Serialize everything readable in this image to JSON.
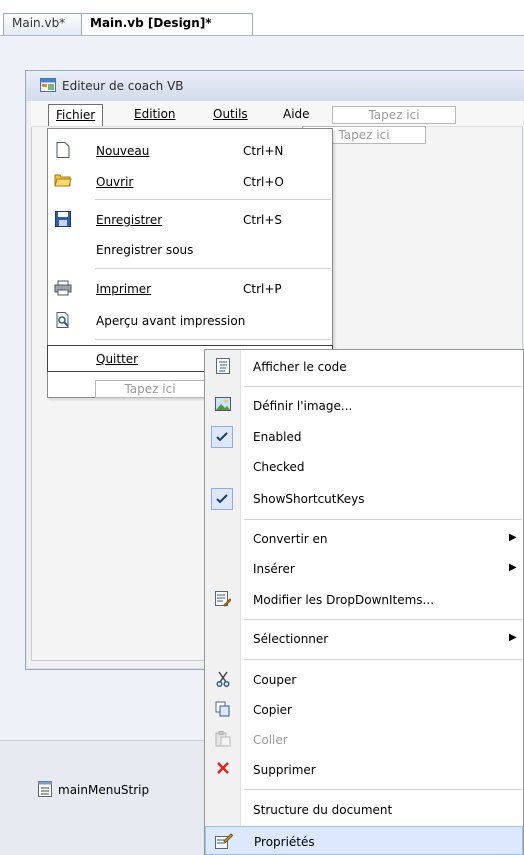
{
  "tabs": [
    {
      "label": "Main.vb*"
    },
    {
      "label": "Main.vb [Design]*"
    }
  ],
  "form": {
    "title": "Editeur de coach VB"
  },
  "menubar": {
    "items": [
      {
        "label": "Fichier"
      },
      {
        "label": "Edition"
      },
      {
        "label": "Outils"
      },
      {
        "label": "Aide"
      }
    ],
    "placeholder_top": "Tapez ici",
    "placeholder_sub": "Tapez ici",
    "placeholder_dropdown": "Tapez ici"
  },
  "fichier_menu": {
    "items": [
      {
        "label": "Nouveau",
        "shortcut": "Ctrl+N",
        "icon": "new-document-icon"
      },
      {
        "label": "Ouvrir",
        "shortcut": "Ctrl+O",
        "icon": "open-folder-icon"
      },
      {
        "label": "Enregistrer",
        "shortcut": "Ctrl+S",
        "icon": "save-icon"
      },
      {
        "label": "Enregistrer sous",
        "shortcut": "",
        "icon": ""
      },
      {
        "label": "Imprimer",
        "shortcut": "Ctrl+P",
        "icon": "print-icon"
      },
      {
        "label": "Aperçu avant impression",
        "shortcut": "",
        "icon": "print-preview-icon"
      },
      {
        "label": "Quitter",
        "shortcut": "",
        "icon": ""
      }
    ]
  },
  "context_menu": {
    "items": [
      {
        "label": "Afficher le code",
        "icon": "view-code-icon"
      },
      {
        "label": "Définir l'image...",
        "icon": "image-icon"
      },
      {
        "label": "Enabled",
        "checked": true
      },
      {
        "label": "Checked",
        "checked": false
      },
      {
        "label": "ShowShortcutKeys",
        "checked": true
      },
      {
        "label": "Convertir en",
        "submenu": true
      },
      {
        "label": "Insérer",
        "submenu": true
      },
      {
        "label": "Modifier les DropDownItems...",
        "icon": "edit-items-icon"
      },
      {
        "label": "Sélectionner",
        "submenu": true
      },
      {
        "label": "Couper",
        "icon": "cut-icon"
      },
      {
        "label": "Copier",
        "icon": "copy-icon"
      },
      {
        "label": "Coller",
        "icon": "paste-icon",
        "disabled": true
      },
      {
        "label": "Supprimer",
        "icon": "delete-icon"
      },
      {
        "label": "Structure du document"
      },
      {
        "label": "Propriétés",
        "icon": "properties-icon",
        "highlighted": true
      }
    ]
  },
  "tray": {
    "component": "mainMenuStrip"
  },
  "colors": {
    "accent": "#3399ff",
    "delete": "#e02020",
    "check_bg": "#dde7f7"
  }
}
